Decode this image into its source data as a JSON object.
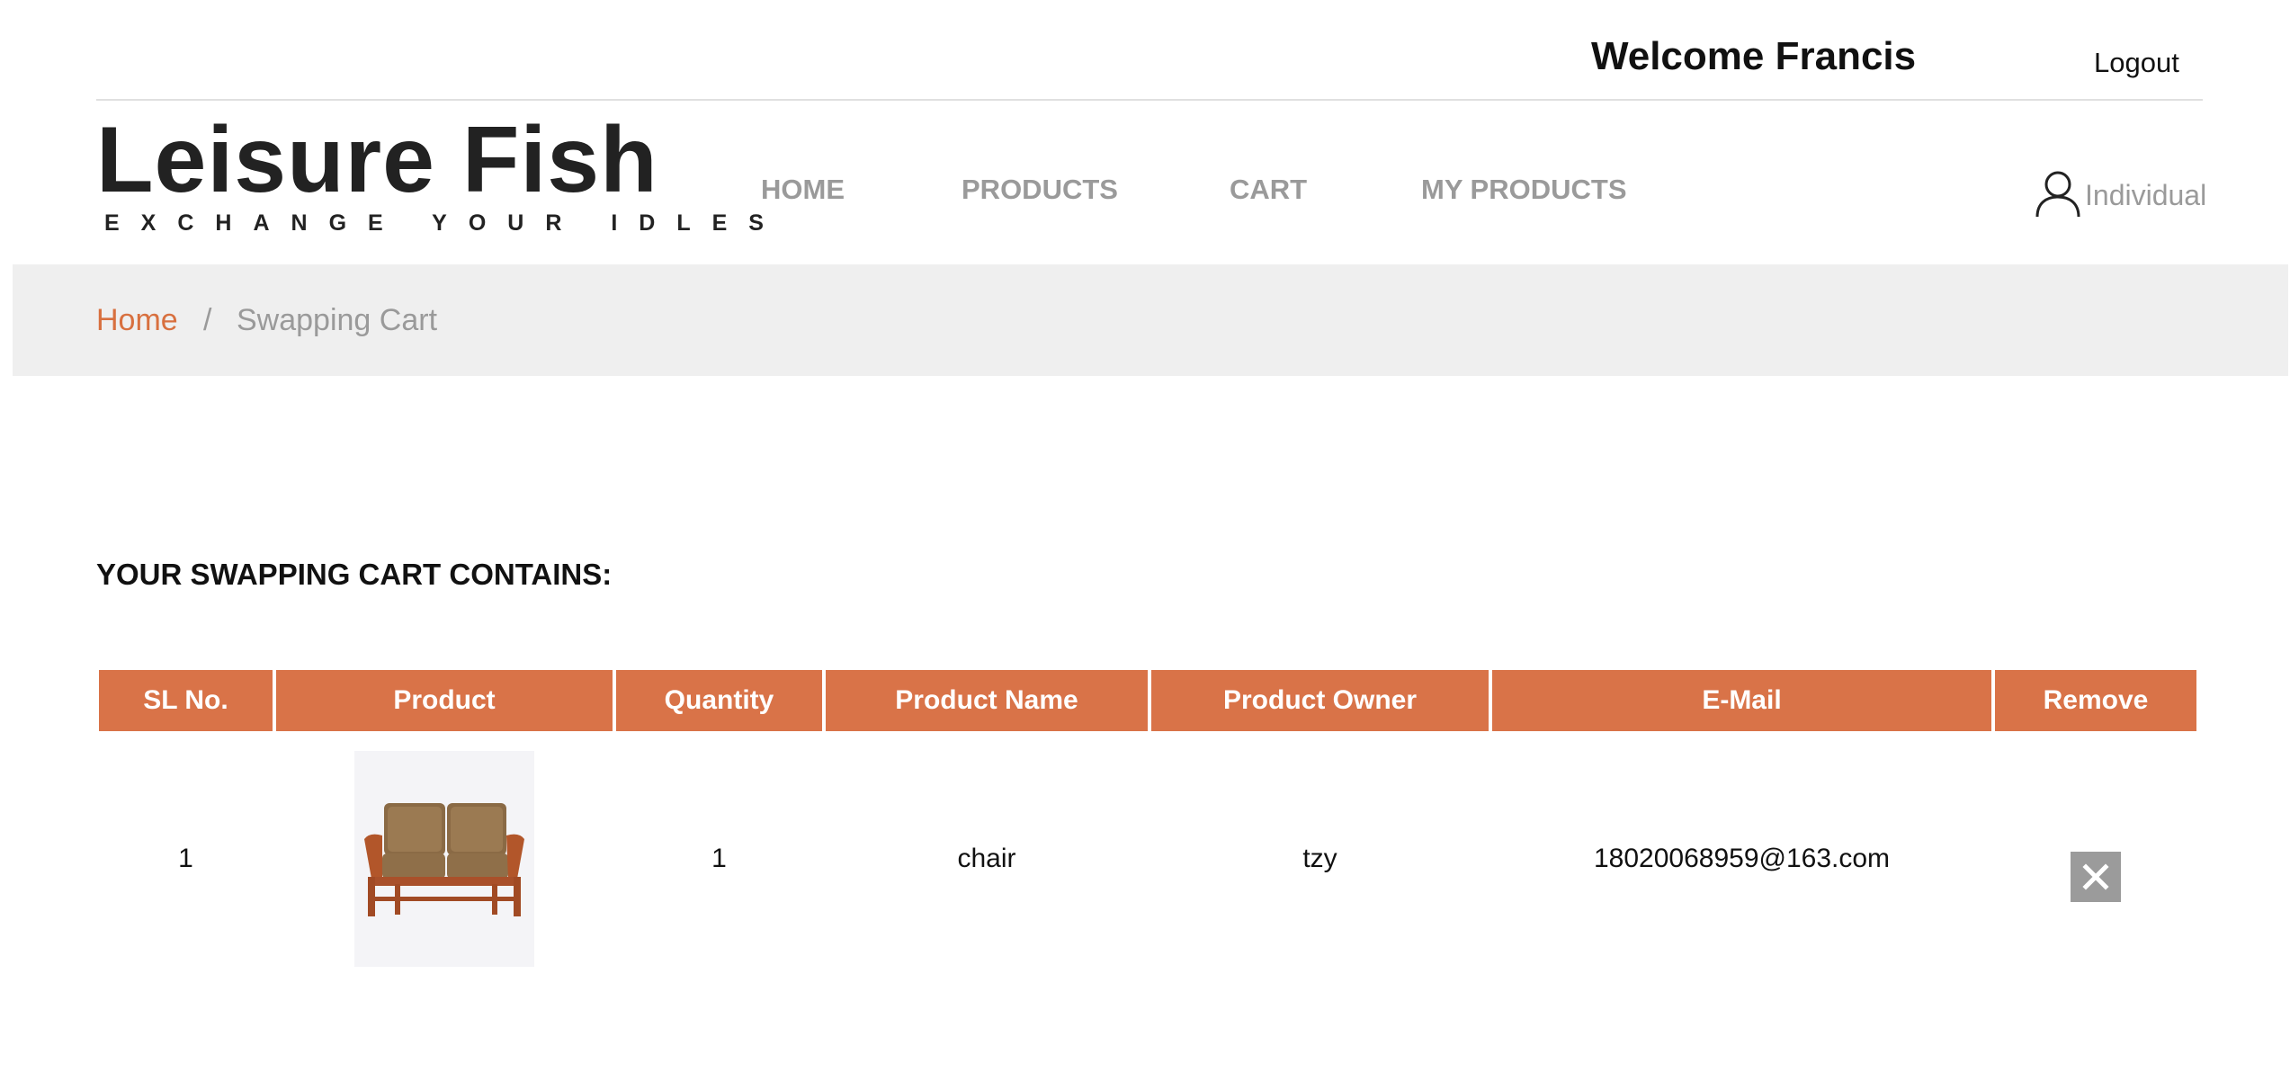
{
  "topbar": {
    "welcome": "Welcome Francis",
    "logout": "Logout"
  },
  "logo": {
    "title": "Leisure Fish",
    "tagline": "EXCHANGE YOUR IDLES"
  },
  "nav": {
    "items": [
      {
        "label": "HOME"
      },
      {
        "label": "PRODUCTS"
      },
      {
        "label": "CART"
      },
      {
        "label": "MY PRODUCTS"
      }
    ]
  },
  "user": {
    "icon": "user-icon",
    "label": "Individual"
  },
  "breadcrumb": {
    "home": "Home",
    "separator": "/",
    "current": "Swapping Cart"
  },
  "cart": {
    "heading": "YOUR SWAPPING CART CONTAINS:",
    "columns": [
      "SL No.",
      "Product",
      "Quantity",
      "Product Name",
      "Product Owner",
      "E-Mail",
      "Remove"
    ],
    "rows": [
      {
        "sl": "1",
        "product_image": "sofa-image",
        "quantity": "1",
        "name": "chair",
        "owner": "tzy",
        "email": "18020068959@163.com",
        "remove_icon": "close-icon"
      }
    ]
  },
  "colors": {
    "accent": "#d97348",
    "breadcrumb_link": "#d8703f",
    "nav_text": "#9a9a9a",
    "breadcrumb_bg": "#efefef",
    "remove_bg": "#9b9b9b"
  }
}
